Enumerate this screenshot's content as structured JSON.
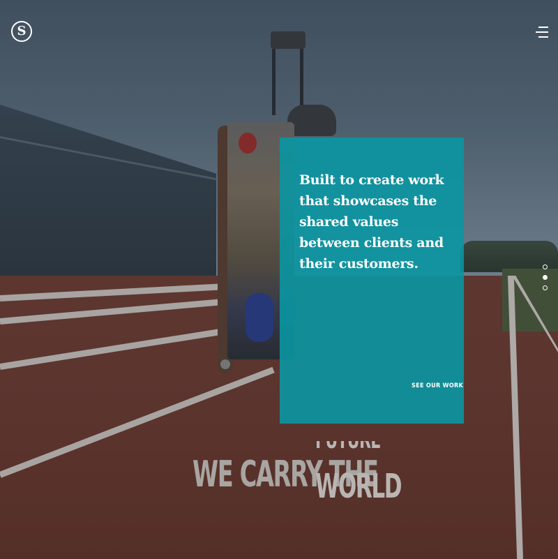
{
  "brand": {
    "logo_mark": "S",
    "logo_icon": "circle-s-logo-icon"
  },
  "nav": {
    "menu_icon": "hamburger-menu-icon"
  },
  "hero": {
    "card_headline": "Built to create work that showcases the shared values between clients and their customers.",
    "card_link": "SEE OUR WORK",
    "card_color": "#0a96a2",
    "big_headline": "WE CARRY THE",
    "rotating_word_current": "WORLD",
    "rotating_word_next": "FUTURE"
  },
  "slider": {
    "count": 3,
    "active_index": 1
  }
}
